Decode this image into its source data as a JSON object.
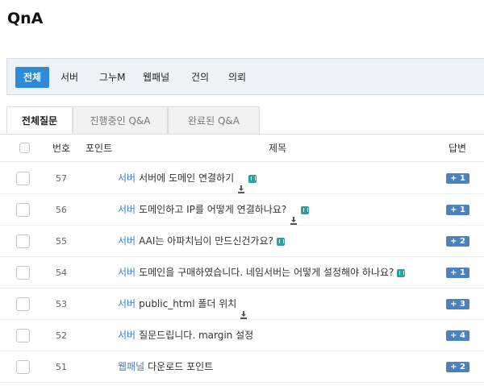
{
  "page": {
    "title": "QnA"
  },
  "categories": [
    "전체",
    "서버",
    "그누M",
    "웹패널",
    "건의",
    "의뢰"
  ],
  "tabs": [
    "전체질문",
    "진행중인 Q&A",
    "완료된 Q&A"
  ],
  "columns": {
    "number": "번호",
    "points": "포인트",
    "subject": "제목",
    "answers": "답변"
  },
  "rows": [
    {
      "number": "57",
      "category": "서버",
      "title": "서버에 도메인 연결하기",
      "download": true,
      "comment": true,
      "answers": "+ 1"
    },
    {
      "number": "56",
      "category": "서버",
      "title": "도메인하고 IP를 어떻게 연결하나요?",
      "download": true,
      "comment": true,
      "answers": "+ 1"
    },
    {
      "number": "55",
      "category": "서버",
      "title": "AAI는 아파치님이 만드신건가요?",
      "download": false,
      "comment": true,
      "answers": "+ 2"
    },
    {
      "number": "54",
      "category": "서버",
      "title": "도메인을 구매하였습니다. 네임서버는 어떻게 설정해야 하나요?",
      "download": false,
      "comment": true,
      "answers": "+ 1"
    },
    {
      "number": "53",
      "category": "서버",
      "title": "public_html 폴더 위치",
      "download": true,
      "comment": false,
      "answers": "+ 3"
    },
    {
      "number": "52",
      "category": "서버",
      "title": "질문드립니다. margin 설정",
      "download": false,
      "comment": false,
      "answers": "+ 4"
    },
    {
      "number": "51",
      "category": "웹패널",
      "title": "다운로드 포인트",
      "download": false,
      "comment": false,
      "answers": "+ 2"
    }
  ],
  "colors": {
    "accent": "#2f8ad8",
    "category_link": "#3a83c9",
    "badge": "#4a82bf",
    "comment_icon": "#2aa0a6"
  },
  "icons": {
    "download": "download-icon",
    "comment": "comment-icon"
  }
}
